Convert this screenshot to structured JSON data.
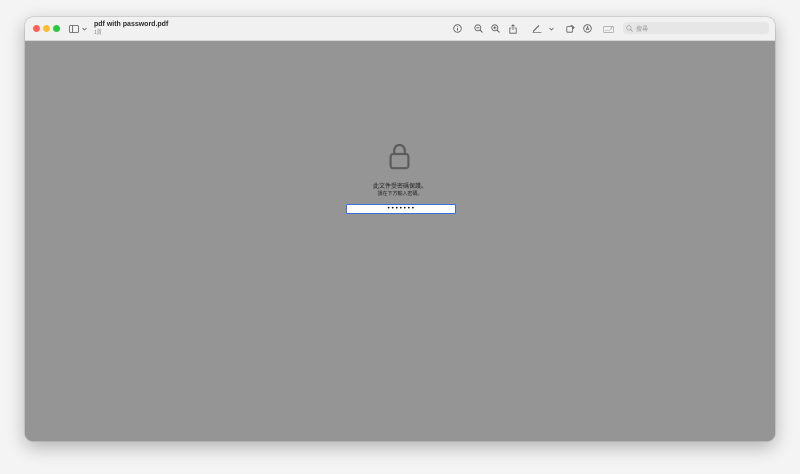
{
  "window": {
    "title": "pdf with password.pdf",
    "subtitle": "1頁"
  },
  "toolbar": {
    "sidebar_icon": "sidebar-icon",
    "sidebar_chevron": "chevron-down-icon",
    "info_icon": "info-icon",
    "zoom_out_icon": "zoom-out-icon",
    "zoom_in_icon": "zoom-in-icon",
    "share_icon": "share-icon",
    "markup_icon": "pen-icon",
    "markup_chevron": "chevron-down-icon",
    "rotate_icon": "rotate-icon",
    "annotate_icon": "annotate-icon",
    "form_icon": "form-icon"
  },
  "search": {
    "placeholder": "搜尋"
  },
  "lock_screen": {
    "icon": "lock-icon",
    "message": "此文件受密碼保護。",
    "instruction": "請在下方輸入密碼。",
    "password_value": "•••••••"
  },
  "colors": {
    "content_bg": "#959595",
    "titlebar_bg": "#f1f1f1",
    "focus_ring": "#3a6dd8",
    "close": "#ff5f57",
    "minimize": "#febc2e",
    "maximize": "#28c840"
  }
}
